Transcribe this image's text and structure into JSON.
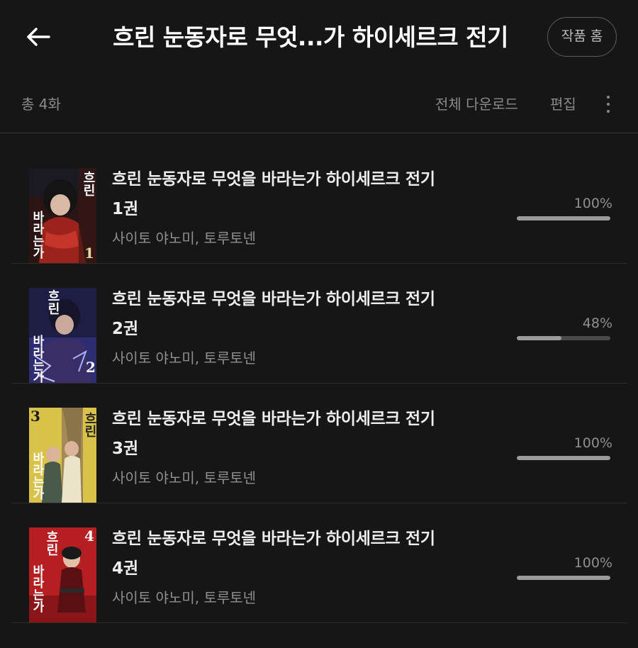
{
  "header": {
    "title": "흐린 눈동자로 무엇...가 하이세르크 전기",
    "home_button": "작품 홈"
  },
  "toolbar": {
    "total": "총 4화",
    "download_all": "전체 다운로드",
    "edit": "편집"
  },
  "items": [
    {
      "title": "흐린 눈동자로 무엇을 바라는가 하이세르크 전기",
      "volume": "1권",
      "author": "사이토 야노미, 토루토넨",
      "progress_label": "100%",
      "progress": 1.0,
      "cover_number": "1",
      "cover_text": "흐린 눈동자로 무엇을 바라는가",
      "cover_color": "#5a1f1a"
    },
    {
      "title": "흐린 눈동자로 무엇을 바라는가 하이세르크 전기",
      "volume": "2권",
      "author": "사이토 야노미, 토루토넨",
      "progress_label": "48%",
      "progress": 0.48,
      "cover_number": "2",
      "cover_text": "흐린 눈동자로 무엇을 바라는가",
      "cover_color": "#2c2a5e"
    },
    {
      "title": "흐린 눈동자로 무엇을 바라는가 하이세르크 전기",
      "volume": "3권",
      "author": "사이토 야노미, 토루토넨",
      "progress_label": "100%",
      "progress": 1.0,
      "cover_number": "3",
      "cover_text": "흐린 눈동자로 무엇을 바라는가",
      "cover_color": "#c9b53a"
    },
    {
      "title": "흐린 눈동자로 무엇을 바라는가 하이세르크 전기",
      "volume": "4권",
      "author": "사이토 야노미, 토루토넨",
      "progress_label": "100%",
      "progress": 1.0,
      "cover_number": "4",
      "cover_text": "흐린 눈동자로 무엇을 바라는가",
      "cover_color": "#b51f22"
    }
  ],
  "icons": {
    "back": "arrow-left-icon",
    "more": "more-vertical-icon"
  },
  "colors": {
    "background": "#161616",
    "progress_fill": "#9b9b9b",
    "progress_track": "#4a4a4a"
  }
}
